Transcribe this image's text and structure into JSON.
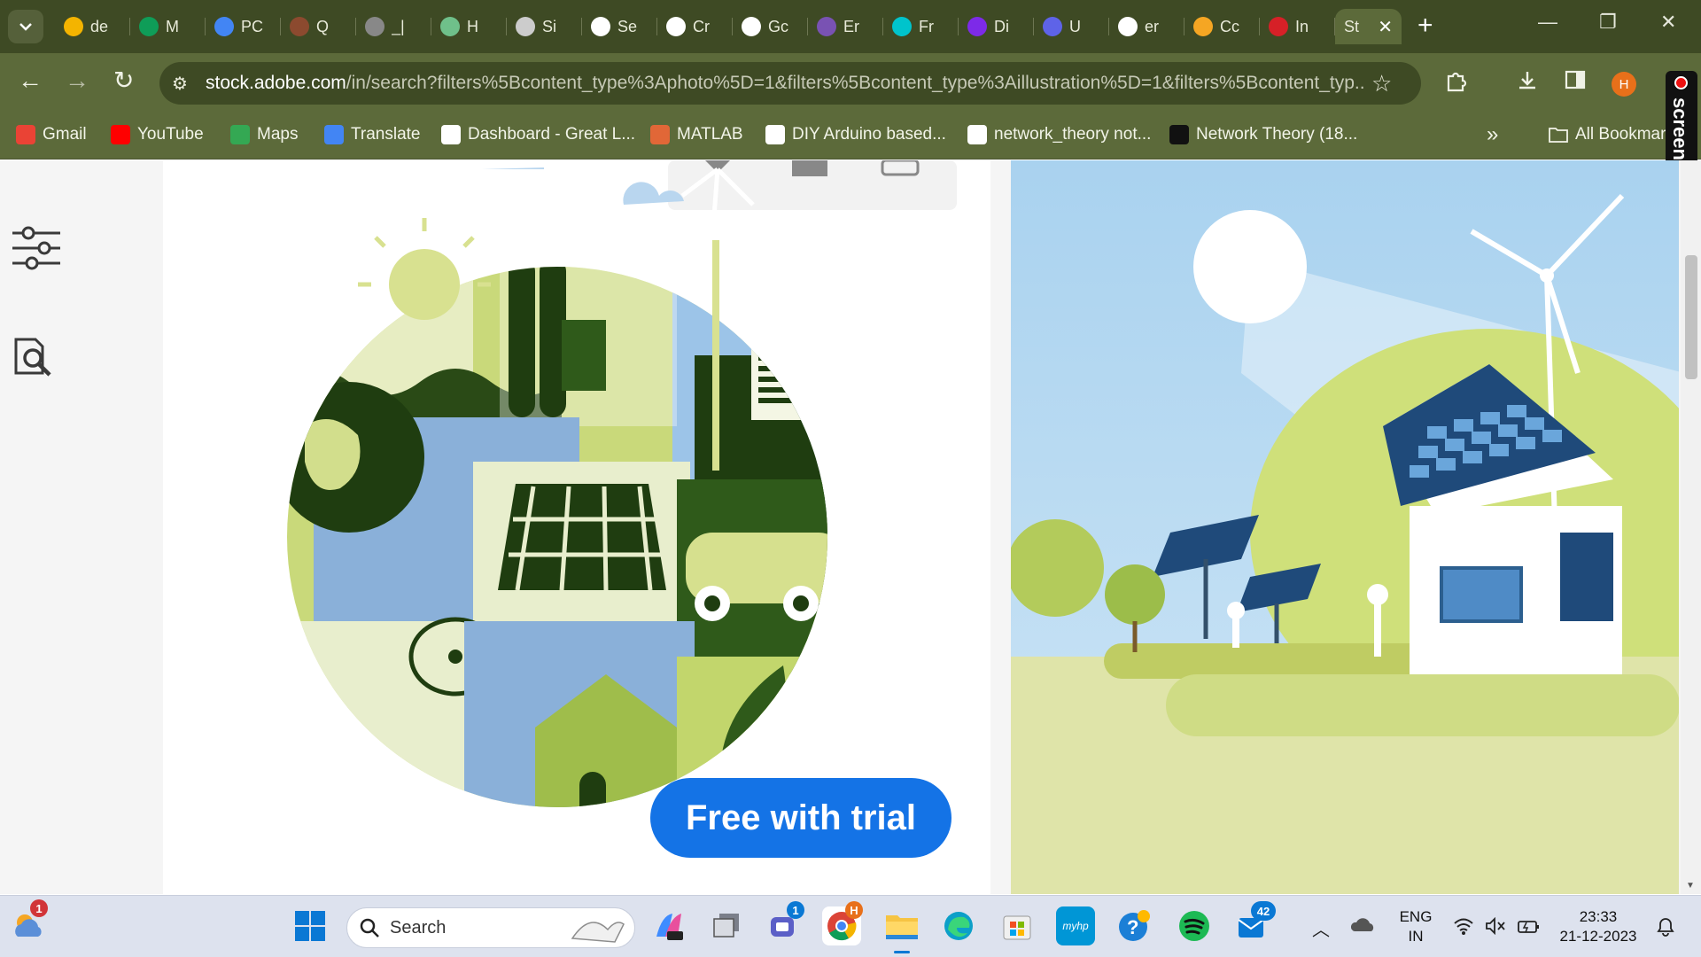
{
  "browser": {
    "tabs": [
      {
        "title": "de",
        "icon": "google-drive-icon",
        "color": "#f4b400"
      },
      {
        "title": "M",
        "icon": "google-drive-icon",
        "color": "#0f9d58"
      },
      {
        "title": "PC",
        "icon": "google-drive-icon",
        "color": "#4285f4"
      },
      {
        "title": "Q",
        "icon": "quora-icon",
        "color": "#8c4a2f"
      },
      {
        "title": "_|",
        "icon": "globe-icon",
        "color": "#888888"
      },
      {
        "title": "H",
        "icon": "hackerrank-icon",
        "color": "#6fc08a"
      },
      {
        "title": "Si",
        "icon": "circle-icon",
        "color": "#cccccc"
      },
      {
        "title": "Se",
        "icon": "gear-icon",
        "color": "#ffffff"
      },
      {
        "title": "Cr",
        "icon": "google-icon",
        "color": "#ffffff"
      },
      {
        "title": "Gc",
        "icon": "google-icon",
        "color": "#ffffff"
      },
      {
        "title": "Er",
        "icon": "bootstrap-icon",
        "color": "#7952b3"
      },
      {
        "title": "Fr",
        "icon": "canva-icon",
        "color": "#00c4cc"
      },
      {
        "title": "Di",
        "icon": "canva-icon",
        "color": "#7d2ae8"
      },
      {
        "title": "U",
        "icon": "shield-icon",
        "color": "#5e63e8"
      },
      {
        "title": "er",
        "icon": "google-icon",
        "color": "#ffffff"
      },
      {
        "title": "Cc",
        "icon": "sun-gear-icon",
        "color": "#f5a623"
      },
      {
        "title": "In",
        "icon": "mendeley-icon",
        "color": "#d62027"
      }
    ],
    "active_tab": {
      "title": "St",
      "close": "✕"
    },
    "new_tab": "+",
    "url_domain": "stock.adobe.com",
    "url_path": "/in/search?filters%5Bcontent_type%3Aphoto%5D=1&filters%5Bcontent_type%3Aillustration%5D=1&filters%5Bcontent_typ...",
    "profile_initial": "H",
    "bookmarks": [
      {
        "label": "Gmail",
        "icon": "gmail-icon",
        "color": "#ea4335"
      },
      {
        "label": "YouTube",
        "icon": "youtube-icon",
        "color": "#ff0000"
      },
      {
        "label": "Maps",
        "icon": "maps-icon",
        "color": "#34a853"
      },
      {
        "label": "Translate",
        "icon": "translate-icon",
        "color": "#4285f4"
      },
      {
        "label": "Dashboard - Great L...",
        "icon": "google-icon",
        "color": "#ffffff"
      },
      {
        "label": "MATLAB",
        "icon": "matlab-icon",
        "color": "#e16737"
      },
      {
        "label": "DIY Arduino based...",
        "icon": "globe-icon",
        "color": "#ffffff"
      },
      {
        "label": "network_theory not...",
        "icon": "globe-icon",
        "color": "#ffffff"
      },
      {
        "label": "Network Theory (18...",
        "icon": "scribd-icon",
        "color": "#111111"
      }
    ],
    "overflow": "»",
    "all_bookmarks": "All Bookmar"
  },
  "screenrec": {
    "label": "screenrec"
  },
  "content": {
    "trial_button": "Free with trial"
  },
  "taskbar": {
    "weather_badge": "1",
    "search_placeholder": "Search",
    "teams_badge": "1",
    "chrome_badge": "H",
    "mail_badge": "42",
    "lang_line1": "ENG",
    "lang_line2": "IN",
    "time": "23:33",
    "date": "21-12-2023",
    "colors": {
      "accent": "#1473e6",
      "chrome_frame": "#5c6a3a"
    }
  }
}
